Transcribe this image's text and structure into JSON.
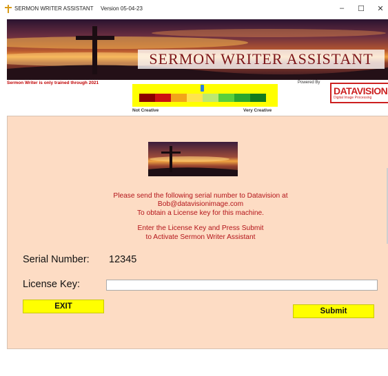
{
  "window": {
    "title": "SERMON WRITER ASSISTANT",
    "version": "Version 05-04-23",
    "minimize": "–",
    "maximize": "☐",
    "close": "✕"
  },
  "banner": {
    "title": "SERMON WRITER ASSISTANT"
  },
  "header": {
    "trained_note": "Sermon Writer is only trained through 2021",
    "powered_by": "Powered By",
    "logo_text": "DATAVISION",
    "logo_subtext": "Digital Image Processing"
  },
  "creativity_meter": {
    "low_label": "Not Creative",
    "high_label": "Very Creative",
    "segment_colors": [
      "#8b0000",
      "#cc1111",
      "#f2a51a",
      "#ffe44d",
      "#bde870",
      "#59cf3c",
      "#2aa62e",
      "#137a1e"
    ],
    "marker_color": "#2f7ee0",
    "level": 0.5
  },
  "instructions": {
    "line1": "Please send the following serial number to Datavision at",
    "line2": "Bob@datavisionimage.com",
    "line3": "To obtain a License key for this machine.",
    "line4": "Enter the License Key and Press Submit",
    "line5": "to Activate Sermon Writer Assistant"
  },
  "form": {
    "serial_label": "Serial Number:",
    "serial_value": "12345",
    "license_label": "License Key:",
    "license_value": ""
  },
  "buttons": {
    "exit": "EXIT",
    "submit": "Submit"
  },
  "colors": {
    "panel_background": "#fddcc4",
    "button_yellow": "#ffff00",
    "instruction_red": "#b3141a",
    "logo_red": "#cc1f1f"
  }
}
